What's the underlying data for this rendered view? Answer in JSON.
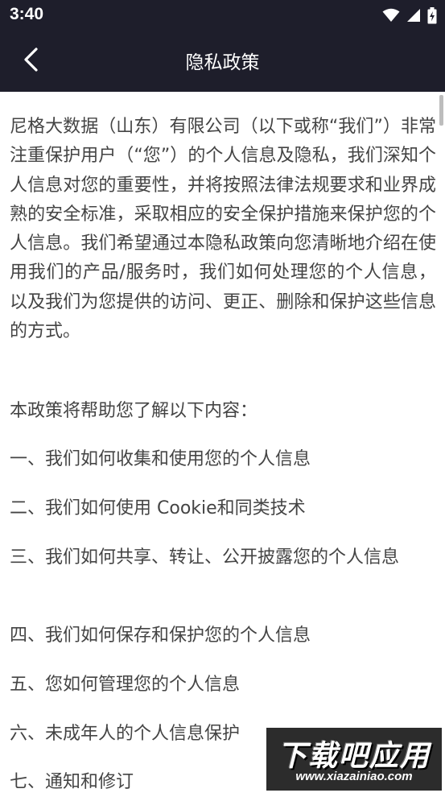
{
  "status_bar": {
    "time": "3:40",
    "icons": [
      "wifi-icon",
      "signal-icon",
      "battery-icon"
    ]
  },
  "appbar": {
    "title": "隐私政策",
    "back_icon": "chevron-left-icon"
  },
  "content": {
    "intro": "尼格大数据（山东）有限公司（以下或称“我们”）非常注重保护用户（“您”）的个人信息及隐私，我们深知个人信息对您的重要性，并将按照法律法规要求和业界成熟的安全标准，采取相应的安全保护措施来保护您的个人信息。我们希望通过本隐私政策向您清晰地介绍在使用我们的产品/服务时，我们如何处理您的个人信息，以及我们为您提供的访问、更正、删除和保护这些信息的方式。",
    "lead": "本政策将帮助您了解以下内容：",
    "sections": [
      "一、我们如何收集和使用您的个人信息",
      "二、我们如何使用 Cookie和同类技术",
      "三、我们如何共享、转让、公开披露您的个人信息",
      "四、我们如何保存和保护您的个人信息",
      "五、您如何管理您的个人信息",
      "六、未成年人的个人信息保护",
      "七、通知和修订"
    ]
  },
  "watermark": {
    "main": "下载吧应用",
    "url": "www.xiazainiao.com"
  },
  "colors": {
    "appbar_bg": "#1e1e2b",
    "text": "#444444",
    "background": "#ffffff"
  }
}
